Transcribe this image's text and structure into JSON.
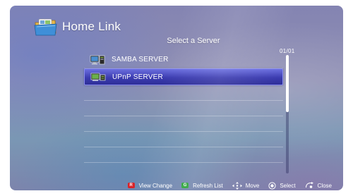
{
  "header": {
    "title": "Home Link",
    "app_icon": "home-link-folder-icon"
  },
  "panel": {
    "title": "Select a Server",
    "page_counter": "01/01",
    "scroll": {
      "position": 0.0,
      "visible_fraction": 0.48
    },
    "servers": [
      {
        "label": "SAMBA SERVER",
        "icon": "pc-monitor-icon",
        "selected": false
      },
      {
        "label": "UPnP SERVER",
        "icon": "network-device-icon",
        "selected": true
      }
    ],
    "empty_rows": 5
  },
  "footer": {
    "view_change": {
      "key": "R",
      "color": "#d8242a",
      "label": "View Change"
    },
    "refresh_list": {
      "key": "G",
      "color": "#2ea43c",
      "label": "Refresh List"
    },
    "move": {
      "icon": "directional-pad-icon",
      "label": "Move"
    },
    "select": {
      "icon": "enter-button-icon",
      "label": "Select"
    },
    "close": {
      "icon": "return-arrow-icon",
      "label": "Close"
    }
  },
  "colors": {
    "selection": "#3c3cb0",
    "background": "#8484b2"
  }
}
